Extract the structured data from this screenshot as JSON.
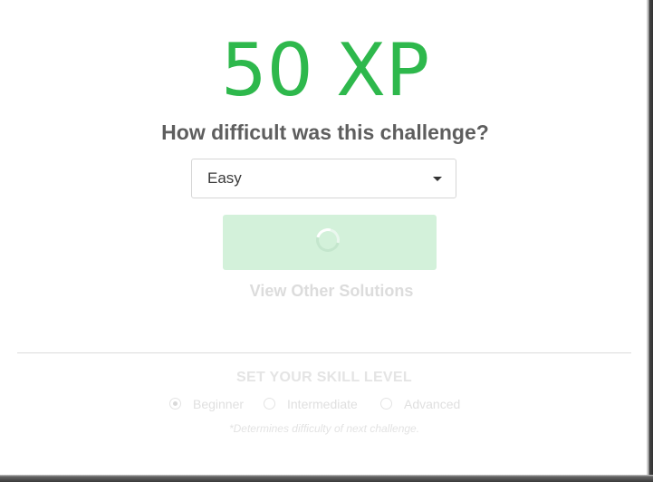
{
  "xp": {
    "label": "50 XP"
  },
  "difficulty": {
    "question": "How difficult was this challenge?",
    "selected": "Easy"
  },
  "submit": {
    "state": "loading"
  },
  "solutions": {
    "link_label": "View Other Solutions"
  },
  "skill": {
    "title": "SET YOUR SKILL LEVEL",
    "options": [
      {
        "label": "Beginner",
        "checked": true
      },
      {
        "label": "Intermediate",
        "checked": false
      },
      {
        "label": "Advanced",
        "checked": false
      }
    ],
    "note": "*Determines difficulty of next challenge."
  },
  "colors": {
    "accent": "#2eb84c",
    "button_bg": "#d3f1da",
    "text": "#5e5e5e"
  }
}
